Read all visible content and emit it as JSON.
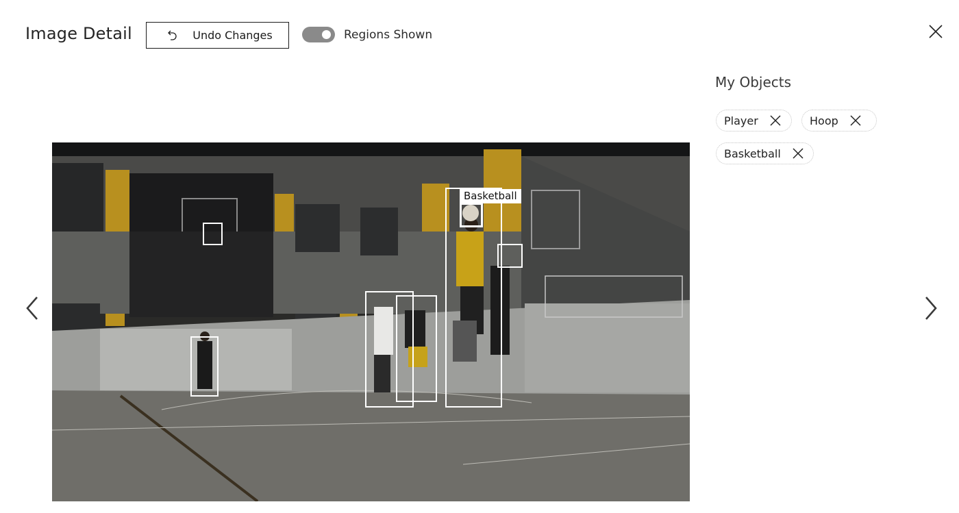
{
  "header": {
    "title": "Image Detail",
    "undo_label": "Undo Changes",
    "undo_icon": "undo-icon",
    "toggle_label": "Regions Shown",
    "toggle_on": true,
    "close_icon": "close-icon"
  },
  "navigation": {
    "prev_icon": "chevron-left-icon",
    "next_icon": "chevron-right-icon"
  },
  "image": {
    "description_icon": "basketball-court-photo",
    "selected_region_label": "Basketball"
  },
  "objects_panel": {
    "title": "My Objects",
    "tags": [
      {
        "label": "Player"
      },
      {
        "label": "Hoop"
      },
      {
        "label": "Basketball"
      }
    ]
  },
  "colors": {
    "region_border": "#ffffff",
    "toggle_track": "#8a8a8a",
    "court_wall_yellow": "#c79a1e"
  }
}
